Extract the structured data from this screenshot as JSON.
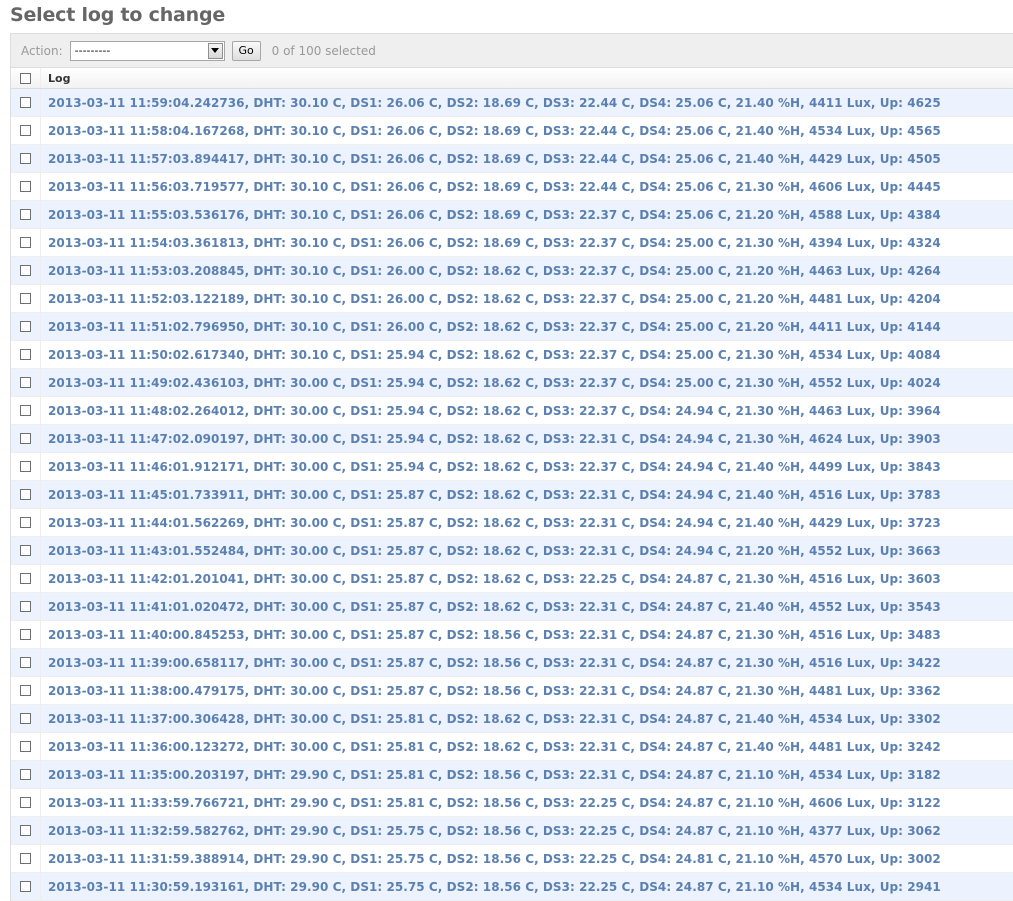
{
  "page": {
    "title": "Select log to change"
  },
  "actions": {
    "label": "Action:",
    "selected_option": "---------",
    "go_label": "Go",
    "selection_counter": "0 of 100 selected"
  },
  "table": {
    "column_header": "Log",
    "rows": [
      "2013-03-11 11:59:04.242736, DHT: 30.10 C, DS1: 26.06 C, DS2: 18.69 C, DS3: 22.44 C, DS4: 25.06 C, 21.40 %H, 4411 Lux, Up: 4625",
      "2013-03-11 11:58:04.167268, DHT: 30.10 C, DS1: 26.06 C, DS2: 18.69 C, DS3: 22.44 C, DS4: 25.06 C, 21.40 %H, 4534 Lux, Up: 4565",
      "2013-03-11 11:57:03.894417, DHT: 30.10 C, DS1: 26.06 C, DS2: 18.69 C, DS3: 22.44 C, DS4: 25.06 C, 21.40 %H, 4429 Lux, Up: 4505",
      "2013-03-11 11:56:03.719577, DHT: 30.10 C, DS1: 26.06 C, DS2: 18.69 C, DS3: 22.44 C, DS4: 25.06 C, 21.30 %H, 4606 Lux, Up: 4445",
      "2013-03-11 11:55:03.536176, DHT: 30.10 C, DS1: 26.06 C, DS2: 18.69 C, DS3: 22.37 C, DS4: 25.06 C, 21.20 %H, 4588 Lux, Up: 4384",
      "2013-03-11 11:54:03.361813, DHT: 30.10 C, DS1: 26.06 C, DS2: 18.69 C, DS3: 22.37 C, DS4: 25.00 C, 21.30 %H, 4394 Lux, Up: 4324",
      "2013-03-11 11:53:03.208845, DHT: 30.10 C, DS1: 26.00 C, DS2: 18.62 C, DS3: 22.37 C, DS4: 25.00 C, 21.20 %H, 4463 Lux, Up: 4264",
      "2013-03-11 11:52:03.122189, DHT: 30.10 C, DS1: 26.00 C, DS2: 18.62 C, DS3: 22.37 C, DS4: 25.00 C, 21.20 %H, 4481 Lux, Up: 4204",
      "2013-03-11 11:51:02.796950, DHT: 30.10 C, DS1: 26.00 C, DS2: 18.62 C, DS3: 22.37 C, DS4: 25.00 C, 21.20 %H, 4411 Lux, Up: 4144",
      "2013-03-11 11:50:02.617340, DHT: 30.10 C, DS1: 25.94 C, DS2: 18.62 C, DS3: 22.37 C, DS4: 25.00 C, 21.30 %H, 4534 Lux, Up: 4084",
      "2013-03-11 11:49:02.436103, DHT: 30.00 C, DS1: 25.94 C, DS2: 18.62 C, DS3: 22.37 C, DS4: 25.00 C, 21.30 %H, 4552 Lux, Up: 4024",
      "2013-03-11 11:48:02.264012, DHT: 30.00 C, DS1: 25.94 C, DS2: 18.62 C, DS3: 22.37 C, DS4: 24.94 C, 21.30 %H, 4463 Lux, Up: 3964",
      "2013-03-11 11:47:02.090197, DHT: 30.00 C, DS1: 25.94 C, DS2: 18.62 C, DS3: 22.31 C, DS4: 24.94 C, 21.30 %H, 4624 Lux, Up: 3903",
      "2013-03-11 11:46:01.912171, DHT: 30.00 C, DS1: 25.94 C, DS2: 18.62 C, DS3: 22.37 C, DS4: 24.94 C, 21.40 %H, 4499 Lux, Up: 3843",
      "2013-03-11 11:45:01.733911, DHT: 30.00 C, DS1: 25.87 C, DS2: 18.62 C, DS3: 22.31 C, DS4: 24.94 C, 21.40 %H, 4516 Lux, Up: 3783",
      "2013-03-11 11:44:01.562269, DHT: 30.00 C, DS1: 25.87 C, DS2: 18.62 C, DS3: 22.31 C, DS4: 24.94 C, 21.40 %H, 4429 Lux, Up: 3723",
      "2013-03-11 11:43:01.552484, DHT: 30.00 C, DS1: 25.87 C, DS2: 18.62 C, DS3: 22.31 C, DS4: 24.94 C, 21.20 %H, 4552 Lux, Up: 3663",
      "2013-03-11 11:42:01.201041, DHT: 30.00 C, DS1: 25.87 C, DS2: 18.62 C, DS3: 22.25 C, DS4: 24.87 C, 21.30 %H, 4516 Lux, Up: 3603",
      "2013-03-11 11:41:01.020472, DHT: 30.00 C, DS1: 25.87 C, DS2: 18.62 C, DS3: 22.31 C, DS4: 24.87 C, 21.40 %H, 4552 Lux, Up: 3543",
      "2013-03-11 11:40:00.845253, DHT: 30.00 C, DS1: 25.87 C, DS2: 18.56 C, DS3: 22.31 C, DS4: 24.87 C, 21.30 %H, 4516 Lux, Up: 3483",
      "2013-03-11 11:39:00.658117, DHT: 30.00 C, DS1: 25.87 C, DS2: 18.56 C, DS3: 22.31 C, DS4: 24.87 C, 21.30 %H, 4516 Lux, Up: 3422",
      "2013-03-11 11:38:00.479175, DHT: 30.00 C, DS1: 25.87 C, DS2: 18.56 C, DS3: 22.31 C, DS4: 24.87 C, 21.30 %H, 4481 Lux, Up: 3362",
      "2013-03-11 11:37:00.306428, DHT: 30.00 C, DS1: 25.81 C, DS2: 18.62 C, DS3: 22.31 C, DS4: 24.87 C, 21.40 %H, 4534 Lux, Up: 3302",
      "2013-03-11 11:36:00.123272, DHT: 30.00 C, DS1: 25.81 C, DS2: 18.62 C, DS3: 22.31 C, DS4: 24.87 C, 21.40 %H, 4481 Lux, Up: 3242",
      "2013-03-11 11:35:00.203197, DHT: 29.90 C, DS1: 25.81 C, DS2: 18.56 C, DS3: 22.31 C, DS4: 24.87 C, 21.10 %H, 4534 Lux, Up: 3182",
      "2013-03-11 11:33:59.766721, DHT: 29.90 C, DS1: 25.81 C, DS2: 18.56 C, DS3: 22.25 C, DS4: 24.87 C, 21.10 %H, 4606 Lux, Up: 3122",
      "2013-03-11 11:32:59.582762, DHT: 29.90 C, DS1: 25.75 C, DS2: 18.56 C, DS3: 22.25 C, DS4: 24.87 C, 21.10 %H, 4377 Lux, Up: 3062",
      "2013-03-11 11:31:59.388914, DHT: 29.90 C, DS1: 25.75 C, DS2: 18.56 C, DS3: 22.25 C, DS4: 24.81 C, 21.10 %H, 4570 Lux, Up: 3002",
      "2013-03-11 11:30:59.193161, DHT: 29.90 C, DS1: 25.75 C, DS2: 18.56 C, DS3: 22.25 C, DS4: 24.87 C, 21.10 %H, 4534 Lux, Up: 2941"
    ]
  }
}
